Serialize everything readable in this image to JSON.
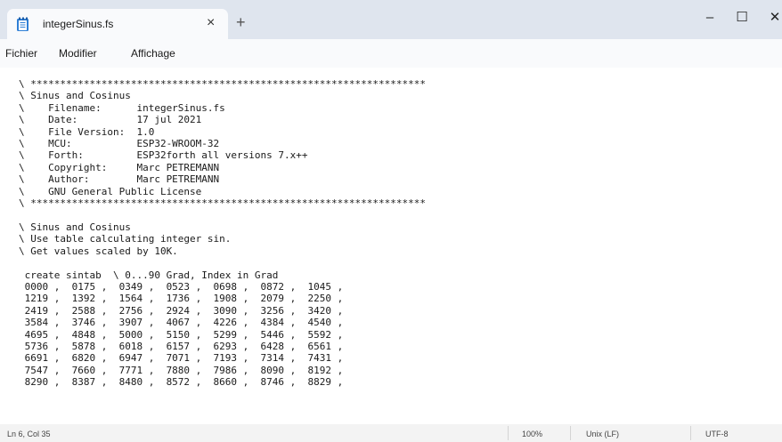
{
  "tab": {
    "title": "integerSinus.fs",
    "close": "×",
    "new": "+"
  },
  "window": {
    "minimize": "–",
    "maximize": "☐",
    "close": "✕"
  },
  "menu": {
    "file": "Fichier",
    "edit": "Modifier",
    "view": "Affichage"
  },
  "editor": {
    "content": "\\ *******************************************************************\n\\ Sinus and Cosinus\n\\    Filename:      integerSinus.fs\n\\    Date:          17 jul 2021\n\\    File Version:  1.0\n\\    MCU:           ESP32-WROOM-32\n\\    Forth:         ESP32forth all versions 7.x++\n\\    Copyright:     Marc PETREMANN\n\\    Author:        Marc PETREMANN\n\\    GNU General Public License\n\\ *******************************************************************\n\n\\ Sinus and Cosinus\n\\ Use table calculating integer sin.\n\\ Get values scaled by 10K.\n\n create sintab  \\ 0...90 Grad, Index in Grad\n 0000 ,  0175 ,  0349 ,  0523 ,  0698 ,  0872 ,  1045 ,\n 1219 ,  1392 ,  1564 ,  1736 ,  1908 ,  2079 ,  2250 ,\n 2419 ,  2588 ,  2756 ,  2924 ,  3090 ,  3256 ,  3420 ,\n 3584 ,  3746 ,  3907 ,  4067 ,  4226 ,  4384 ,  4540 ,\n 4695 ,  4848 ,  5000 ,  5150 ,  5299 ,  5446 ,  5592 ,\n 5736 ,  5878 ,  6018 ,  6157 ,  6293 ,  6428 ,  6561 ,\n 6691 ,  6820 ,  6947 ,  7071 ,  7193 ,  7314 ,  7431 ,\n 7547 ,  7660 ,  7771 ,  7880 ,  7986 ,  8090 ,  8192 ,\n 8290 ,  8387 ,  8480 ,  8572 ,  8660 ,  8746 ,  8829 ,"
  },
  "status": {
    "position": "Ln 6, Col 35",
    "zoom": "100%",
    "line_ending": "Unix (LF)",
    "encoding": "UTF-8"
  }
}
